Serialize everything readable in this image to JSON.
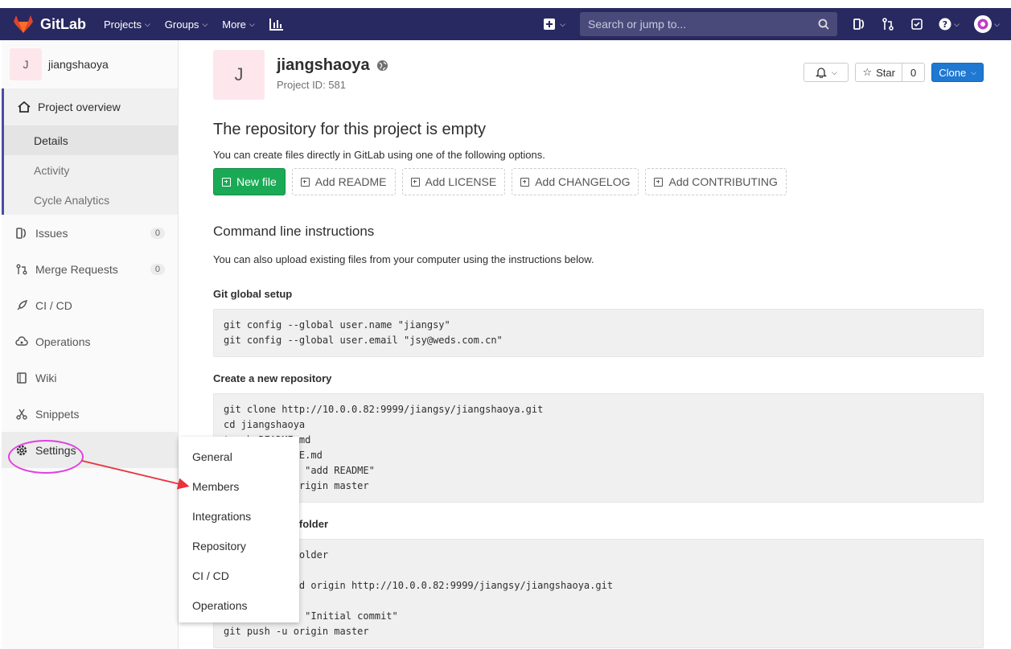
{
  "nav": {
    "brand": "GitLab",
    "projects": "Projects",
    "groups": "Groups",
    "more": "More",
    "search_placeholder": "Search or jump to..."
  },
  "sidebar": {
    "avatar_letter": "J",
    "project_name": "jiangshaoya",
    "overview": "Project overview",
    "sub_items": [
      "Details",
      "Activity",
      "Cycle Analytics"
    ],
    "issues": "Issues",
    "issues_count": "0",
    "merge_requests": "Merge Requests",
    "mr_count": "0",
    "cicd": "CI / CD",
    "operations": "Operations",
    "wiki": "Wiki",
    "snippets": "Snippets",
    "settings": "Settings"
  },
  "flyout": {
    "items": [
      "General",
      "Members",
      "Integrations",
      "Repository",
      "CI / CD",
      "Operations"
    ]
  },
  "project": {
    "avatar_letter": "J",
    "title": "jiangshaoya",
    "id_text": "Project ID: 581",
    "star_label": "Star",
    "star_count": "0",
    "clone_label": "Clone"
  },
  "empty": {
    "heading": "The repository for this project is empty",
    "subtitle": "You can create files directly in GitLab using one of the following options.",
    "new_file": "New file",
    "add_readme": "Add README",
    "add_license": "Add LICENSE",
    "add_changelog": "Add CHANGELOG",
    "add_contributing": "Add CONTRIBUTING"
  },
  "cli": {
    "heading": "Command line instructions",
    "subtitle": "You can also upload existing files from your computer using the instructions below.",
    "global_setup": "Git global setup",
    "global_setup_code": "git config --global user.name \"jiangsy\"\ngit config --global user.email \"jsy@weds.com.cn\"",
    "new_repo": "Create a new repository",
    "new_repo_code": "git clone http://10.0.0.82:9999/jiangsy/jiangshaoya.git\ncd jiangshaoya\ntouch README.md\ngit add README.md\ngit commit -m \"add README\"\ngit push -u origin master",
    "existing_folder": "Push an existing folder",
    "existing_folder_code": "cd existing_folder\ngit init\ngit remote add origin http://10.0.0.82:9999/jiangsy/jiangshaoya.git\ngit add .\ngit commit -m \"Initial commit\"\ngit push -u origin master"
  },
  "colors": {
    "navbar": "#292961",
    "sidebar_accent": "#4b4ba3",
    "new_file_green": "#1aaa55",
    "clone_blue": "#1f78d1",
    "highlight_magenta": "#e040e0",
    "arrow_red": "#e8333f"
  }
}
